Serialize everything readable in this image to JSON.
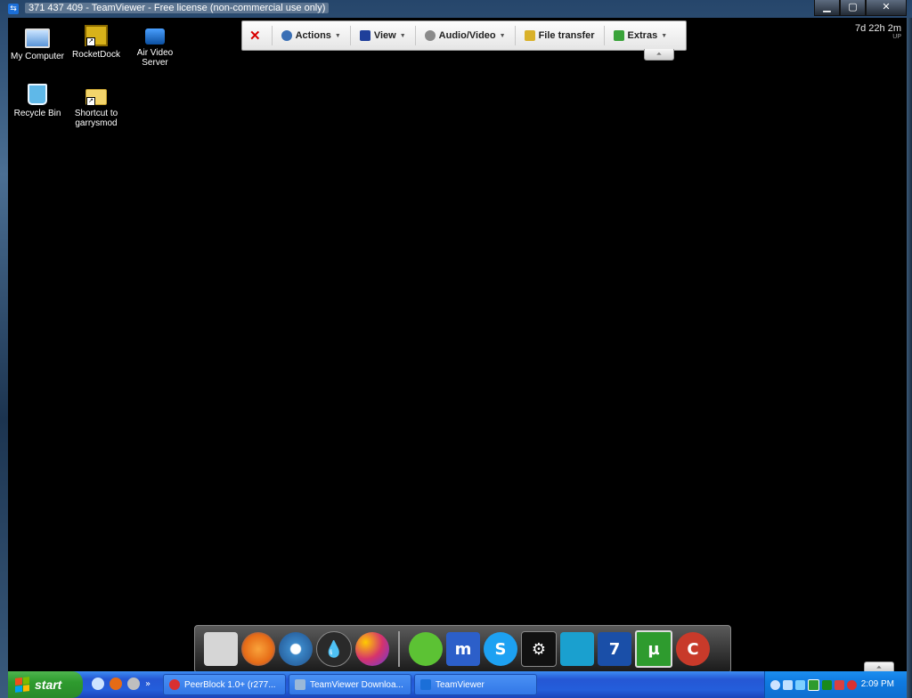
{
  "window": {
    "title": "371 437 409 - TeamViewer - Free license (non-commercial use only)",
    "buttons": {
      "minimize": "▁",
      "maximize": "▢",
      "close": "✕"
    }
  },
  "desktop": {
    "icons": [
      {
        "label": "My Computer",
        "icon": "computer-icon"
      },
      {
        "label": "RocketDock",
        "icon": "rocketdock-icon"
      },
      {
        "label": "Air Video Server",
        "icon": "tv-icon"
      },
      {
        "label": "Recycle Bin",
        "icon": "recycle-bin-icon"
      },
      {
        "label": "Shortcut to garrysmod",
        "icon": "folder-icon"
      }
    ],
    "uptime": {
      "value": "7d 22h 2m",
      "label": "UP"
    }
  },
  "toolbar": {
    "close": "✕",
    "items": [
      {
        "label": "Actions",
        "icon": "gear-icon",
        "color": "#3a6fb5"
      },
      {
        "label": "View",
        "icon": "monitor-icon",
        "color": "#1f3f9a"
      },
      {
        "label": "Audio/Video",
        "icon": "audio-video-icon",
        "color": "#8a8a8a"
      },
      {
        "label": "File transfer",
        "icon": "file-transfer-icon",
        "color": "#d9b12a"
      },
      {
        "label": "Extras",
        "icon": "puzzle-icon",
        "color": "#3aa33a"
      }
    ],
    "collapse": "⏶"
  },
  "dock": {
    "items": [
      {
        "icon": "finder-icon",
        "color": "#d6d6d6"
      },
      {
        "icon": "firefox-icon",
        "color": "#e66b16"
      },
      {
        "icon": "chrome-icon",
        "color": "#3b87c8"
      },
      {
        "icon": "drop-icon",
        "color": "#2a2a2a"
      },
      {
        "icon": "colors-icon",
        "color": "#d6336c"
      },
      {
        "icon": "frog-icon",
        "color": "#5cc234"
      },
      {
        "icon": "mirc-icon",
        "color": "#2c5fc9"
      },
      {
        "icon": "skype-icon",
        "color": "#1da1f2"
      },
      {
        "icon": "steam-icon",
        "color": "#111111"
      },
      {
        "icon": "cube-icon",
        "color": "#1aa0cf"
      },
      {
        "icon": "teamviewer-icon",
        "color": "#1a4fa8"
      },
      {
        "icon": "utorrent-icon",
        "color": "#2e9b2e"
      },
      {
        "icon": "ccleaner-icon",
        "color": "#c83a2a"
      }
    ],
    "collapse": "⏶"
  },
  "taskbar": {
    "start": "start",
    "quick_launch_more": "»",
    "tasks": [
      {
        "label": "PeerBlock 1.0+ (r277...",
        "icon": "peerblock-icon",
        "color": "#d93030"
      },
      {
        "label": "TeamViewer Downloa...",
        "icon": "teamviewer-icon",
        "color": "#9ab8d8"
      },
      {
        "label": "TeamViewer",
        "icon": "teamviewer-icon",
        "color": "#1b6fd8"
      }
    ],
    "clock": "2:09 PM"
  }
}
